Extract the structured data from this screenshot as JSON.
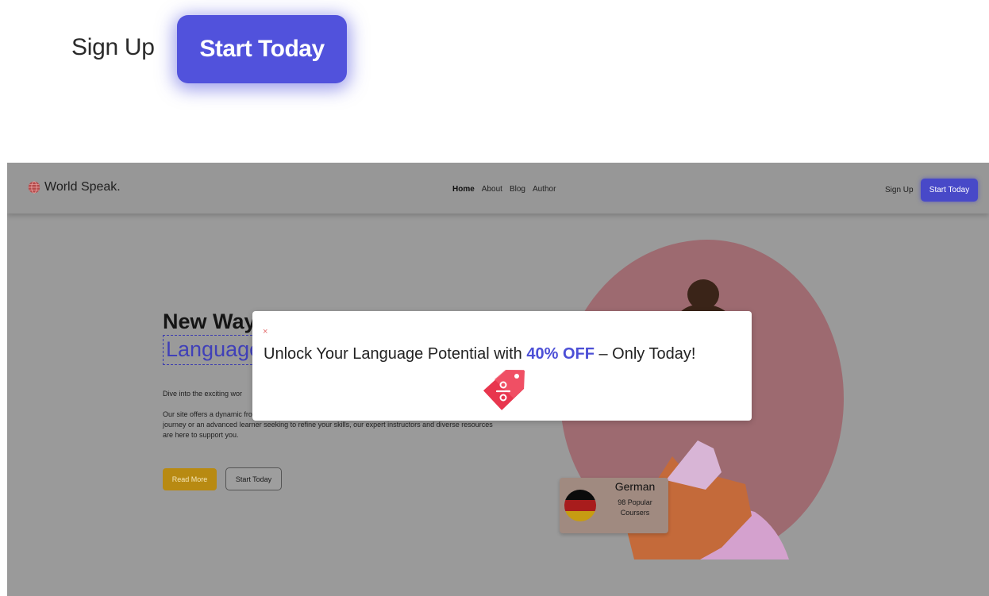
{
  "zoom": {
    "signup_label": "Sign Up",
    "start_label": "Start Today"
  },
  "navbar": {
    "logo_text": "World Speak.",
    "links": [
      "Home",
      "About",
      "Blog",
      "Author"
    ],
    "active_link": "Home",
    "signup_label": "Sign Up",
    "start_label": "Start Today"
  },
  "hero": {
    "title_line1": "New Way ",
    "title_line2": "Language",
    "paragraph1": "Dive into the exciting wor",
    "paragraph2": "Our site offers a dynamic from around the globe. Whether you're a beginner embarking on your linguistic journey or an advanced learner seeking to refine your skills, our expert instructors and diverse resources are here to support you.",
    "read_more_label": "Read More",
    "start_label": "Start Today"
  },
  "course_card": {
    "title": "German",
    "subtitle_line1": "98 Popular",
    "subtitle_line2": "Coursers"
  },
  "modal": {
    "close_icon": "×",
    "text_before": "Unlock Your Language Potential with ",
    "highlight": "40% OFF",
    "text_after": " – Only Today!",
    "icon": "discount-tag-icon"
  },
  "colors": {
    "accent": "#5152dc",
    "highlight": "#4c4fd6",
    "read_more": "#b88a12",
    "blob": "#9d6a70",
    "tag": "#e8364e"
  }
}
